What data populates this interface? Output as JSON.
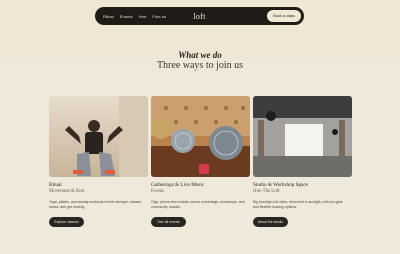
{
  "nav": {
    "links": [
      "Ritual",
      "Events",
      "Hire",
      "Find us"
    ],
    "logo": "loft",
    "cta": "Book a class"
  },
  "section": {
    "eyebrow": "What we do",
    "headline": "Three ways to join us"
  },
  "cards": [
    {
      "title": "Ritual",
      "subtitle": "Movement & Rest",
      "description": "Yoga, pilates, and sweaty workouts to feel stronger, release stress, and get moving.",
      "button": "Explore classes"
    },
    {
      "title": "Gatherings & Live Music",
      "subtitle": "Events",
      "description": "Gigs, phone-free socials, secret screenings, workshops, and community socials.",
      "button": "See all events"
    },
    {
      "title": "Studio & Workshop Space",
      "subtitle": "Hire The Loft",
      "description": "Big brooklyn-loft vibes, drenched in sunlight, with pro gear and flexible booking options.",
      "button": "About the studio"
    }
  ]
}
